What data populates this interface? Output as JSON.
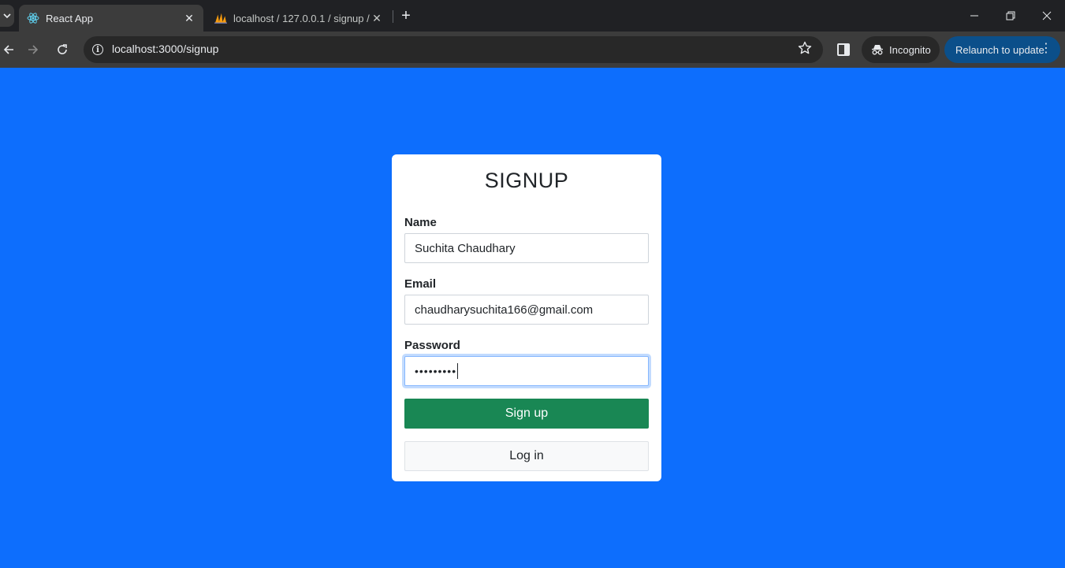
{
  "browser": {
    "tabs": [
      {
        "title": "React App",
        "active": true
      },
      {
        "title": "localhost / 127.0.0.1 / signup / l",
        "active": false
      }
    ],
    "url": "localhost:3000/signup",
    "incognito_label": "Incognito",
    "relaunch_label": "Relaunch to update"
  },
  "form": {
    "title": "SIGNUP",
    "name_label": "Name",
    "name_value": "Suchita Chaudhary",
    "email_label": "Email",
    "email_value": "chaudharysuchita166@gmail.com",
    "password_label": "Password",
    "password_value": "•••••••••",
    "signup_label": "Sign up",
    "login_label": "Log in"
  },
  "colors": {
    "page_background": "#0d6efd",
    "signup_button": "#198754",
    "relaunch_button": "#0b4f8a"
  },
  "icons": [
    "tab-search-icon",
    "react-logo-icon",
    "phpmyadmin-logo-icon",
    "close-icon",
    "plus-icon",
    "minimize-icon",
    "restore-icon",
    "back-icon",
    "forward-icon",
    "reload-icon",
    "site-info-icon",
    "star-icon",
    "side-panel-icon",
    "incognito-icon",
    "more-vert-icon"
  ]
}
